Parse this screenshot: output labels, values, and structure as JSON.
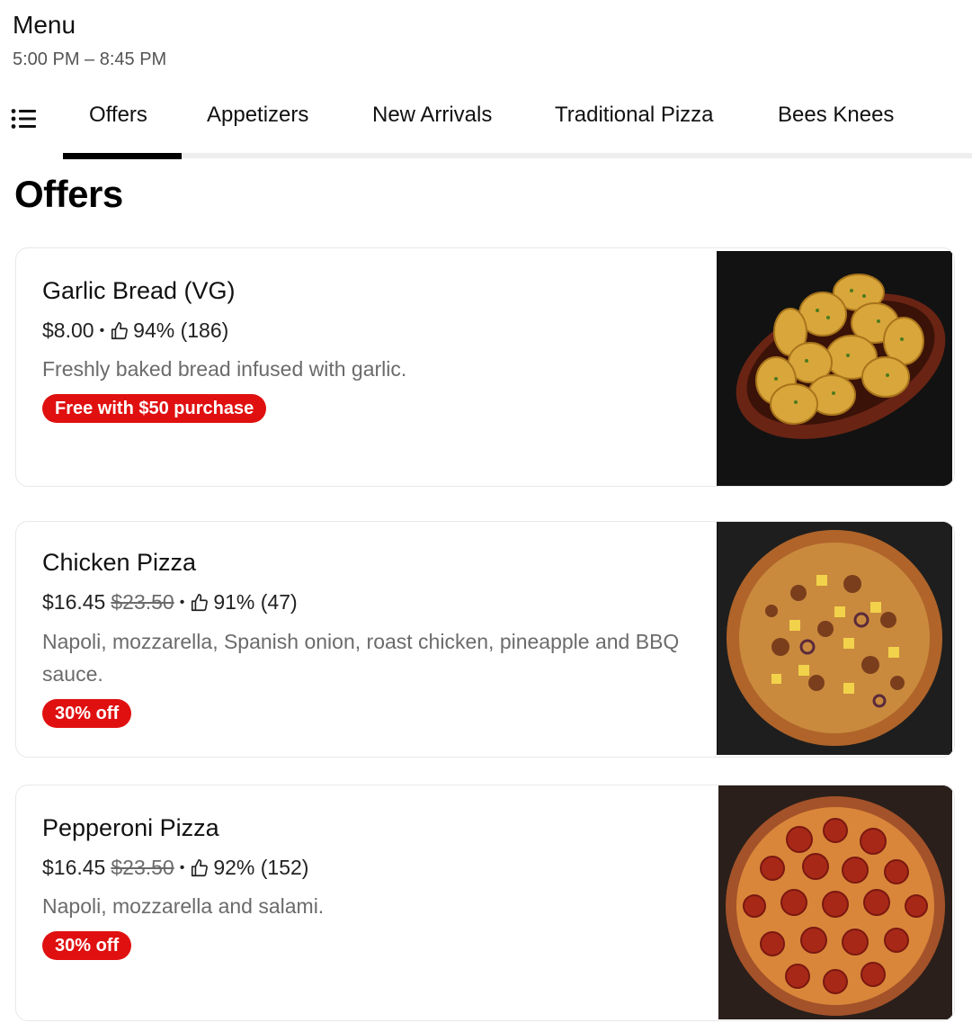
{
  "header": {
    "title": "Menu",
    "hours": "5:00 PM – 8:45 PM"
  },
  "tabs": [
    {
      "label": "Offers",
      "active": true
    },
    {
      "label": "Appetizers"
    },
    {
      "label": "New Arrivals"
    },
    {
      "label": "Traditional Pizza"
    },
    {
      "label": "Bees Knees"
    }
  ],
  "section": {
    "title": "Offers"
  },
  "items": [
    {
      "name": "Garlic Bread (VG)",
      "price": "$8.00",
      "original_price": "",
      "rating": "94% (186)",
      "description": "Freshly baked bread infused with garlic.",
      "badge": "Free with $50 purchase",
      "image": "garlic-bread-photo"
    },
    {
      "name": "Chicken Pizza",
      "price": "$16.45",
      "original_price": "$23.50",
      "rating": "91% (47)",
      "description": "Napoli, mozzarella, Spanish onion, roast chicken, pineapple and BBQ sauce.",
      "badge": "30% off",
      "image": "chicken-pizza-photo"
    },
    {
      "name": "Pepperoni Pizza",
      "price": "$16.45",
      "original_price": "$23.50",
      "rating": "92% (152)",
      "description": "Napoli, mozzarella and salami.",
      "badge": "30% off",
      "image": "pepperoni-pizza-photo"
    }
  ],
  "colors": {
    "badge": "#e01010",
    "text": "#111111",
    "muted": "#6b6b6b",
    "tab_active": "#000000"
  },
  "icons": {
    "menu": "list-icon",
    "rating": "thumbs-up-icon"
  }
}
